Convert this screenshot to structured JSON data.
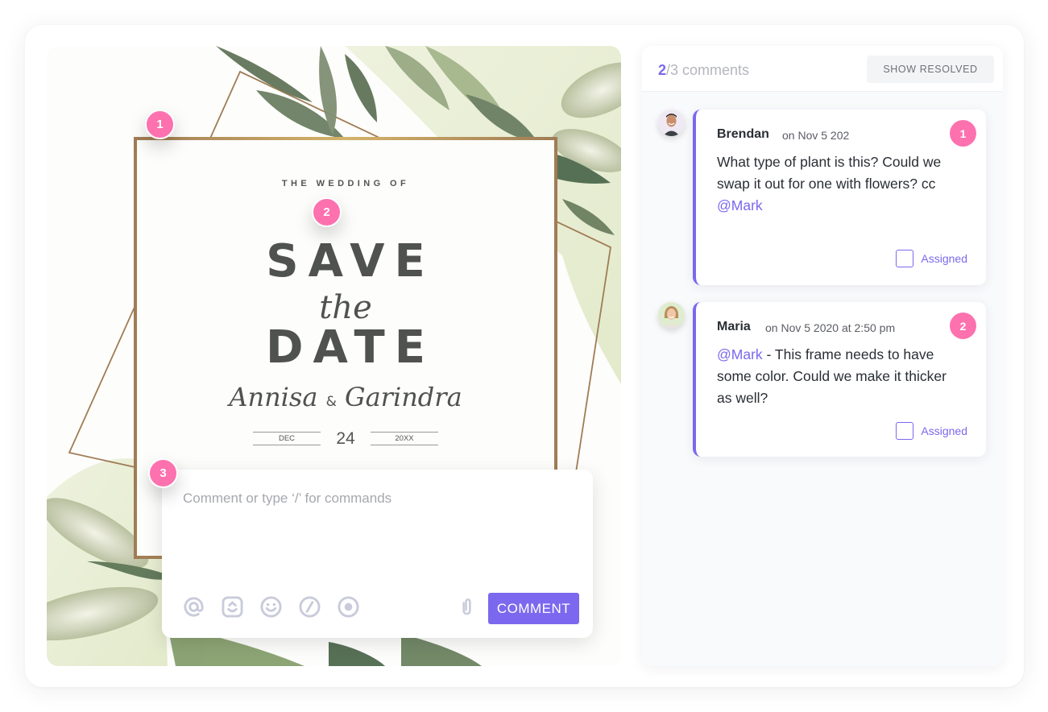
{
  "canvas": {
    "pins": [
      "1",
      "2",
      "3"
    ],
    "invite": {
      "subtitle": "THE WEDDING OF",
      "line1": "SAVE",
      "line2": "the",
      "line3": "DATE",
      "name1": "Annisa",
      "ampersand": "&",
      "name2": "Garindra",
      "month": "DEC",
      "day": "24",
      "year": "20XX"
    }
  },
  "composer": {
    "placeholder": "Comment or type ‘/’ for commands",
    "tools": [
      {
        "icon": "mention-icon",
        "label": "@"
      },
      {
        "icon": "assign-icon",
        "label": "assign"
      },
      {
        "icon": "emoji-icon",
        "label": "emoji"
      },
      {
        "icon": "slash-command-icon",
        "label": "/"
      },
      {
        "icon": "record-icon",
        "label": "record"
      }
    ],
    "attach_icon": "paperclip-icon",
    "submit_label": "COMMENT"
  },
  "panel": {
    "count_current": "2",
    "count_rest": "/3 comments",
    "show_resolved_label": "SHOW RESOLVED",
    "comments": [
      {
        "author": "Brendan",
        "time": "on Nov 5 202",
        "number": "1",
        "text_before": "What type of plant is this? Could we swap it out for one with flowers? cc ",
        "mention": "@Mark",
        "text_after": "",
        "assign_label": "Assigned"
      },
      {
        "author": "Maria",
        "time": "on Nov 5 2020 at 2:50 pm",
        "number": "2",
        "text_before": "",
        "mention": "@Mark",
        "text_after": " - This frame needs to have some color. Could we make it thicker as well?",
        "assign_label": "Assigned"
      }
    ]
  },
  "colors": {
    "accent": "#7b68ee",
    "pin": "#fd71af",
    "frame": "#a07c55",
    "leaf_dark": "#667a5e",
    "leaf_light": "#b8c39e"
  }
}
